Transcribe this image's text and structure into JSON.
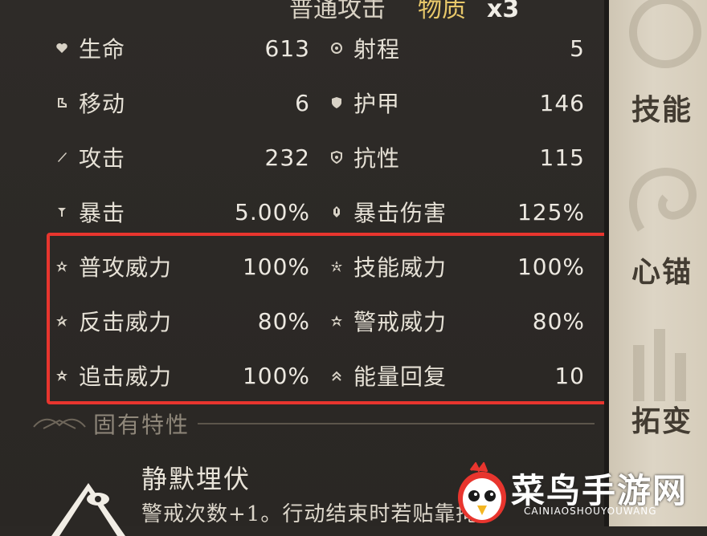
{
  "header": {
    "attack_label": "普通攻击",
    "damage_type": "物质",
    "count": "x3"
  },
  "stats": {
    "left": [
      {
        "label": "生命",
        "value": "613",
        "icon": "heart-icon"
      },
      {
        "label": "移动",
        "value": "6",
        "icon": "boot-icon"
      },
      {
        "label": "攻击",
        "value": "232",
        "icon": "sword-icon"
      },
      {
        "label": "暴击",
        "value": "5.00%",
        "icon": "crit-icon"
      },
      {
        "label": "普攻威力",
        "value": "100%",
        "icon": "attack-power-icon"
      },
      {
        "label": "反击威力",
        "value": "80%",
        "icon": "counter-power-icon"
      },
      {
        "label": "追击威力",
        "value": "100%",
        "icon": "pursuit-power-icon"
      }
    ],
    "right": [
      {
        "label": "射程",
        "value": "5",
        "icon": "range-icon"
      },
      {
        "label": "护甲",
        "value": "146",
        "icon": "armor-icon"
      },
      {
        "label": "抗性",
        "value": "115",
        "icon": "resistance-icon"
      },
      {
        "label": "暴击伤害",
        "value": "125%",
        "icon": "crit-damage-icon"
      },
      {
        "label": "技能威力",
        "value": "100%",
        "icon": "skill-power-icon"
      },
      {
        "label": "警戒威力",
        "value": "80%",
        "icon": "vigilance-power-icon"
      },
      {
        "label": "能量回复",
        "value": "10",
        "icon": "energy-regen-icon"
      }
    ]
  },
  "traits": {
    "section_title": "固有特性",
    "name": "静默埋伏",
    "description": "警戒次数+1。行动结束时若贴靠掩"
  },
  "side_tabs": [
    "技能",
    "心锚",
    "拓变"
  ],
  "watermark": {
    "text": "菜鸟手游网",
    "sub": "CAINIAOSHOUYOUWANG"
  },
  "colors": {
    "panel_bg": "#2b2825",
    "highlight_border": "#e8352e",
    "accent_gold": "#e8c86a",
    "rail_bg": "#d6cdbb"
  }
}
